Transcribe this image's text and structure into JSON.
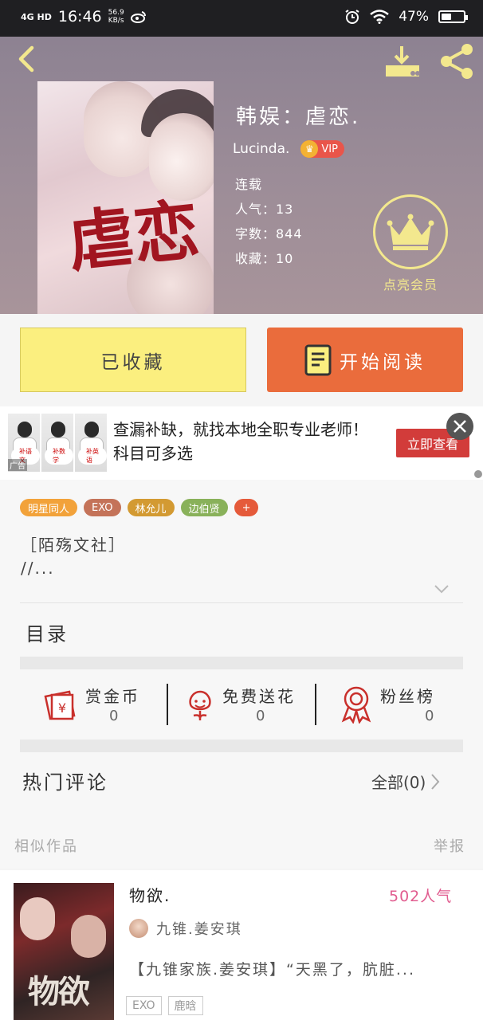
{
  "status_bar": {
    "network": "4G HD",
    "time": "16:46",
    "speed_value": "56.9",
    "speed_unit": "KB/s",
    "battery": "47%",
    "battery_level": 0.47
  },
  "book": {
    "title": "韩娱：虐恋.",
    "cover_char": "虐恋",
    "author": "Lucinda.",
    "vip_label": "VIP",
    "status": "连载",
    "popularity": "人气：13",
    "word_count": "字数：844",
    "favorites": "收藏：10",
    "member_label": "点亮会员"
  },
  "actions": {
    "favorite": "已收藏",
    "read": "开始阅读"
  },
  "ad": {
    "text": "查漏补缺，就找本地全职专业老师！科目可多选",
    "button": "立即查看",
    "mark": "广告",
    "img_tags": [
      "补语文",
      "补数学",
      "补英语"
    ]
  },
  "tags": [
    {
      "label": "明星同人",
      "color": "#f2a23a"
    },
    {
      "label": "EXO",
      "color": "#c47359"
    },
    {
      "label": "林允儿",
      "color": "#d39a32"
    },
    {
      "label": "边伯贤",
      "color": "#89b15a"
    },
    {
      "label": "+",
      "color": "#e55a3a"
    }
  ],
  "description": {
    "line1": "［陌殇文社］",
    "line2": "//..."
  },
  "toc_label": "目录",
  "stats": [
    {
      "title": "赏金币",
      "value": "0"
    },
    {
      "title": "免费送花",
      "value": "0"
    },
    {
      "title": "粉丝榜",
      "value": "0"
    }
  ],
  "comments": {
    "title": "热门评论",
    "all": "全部(0)"
  },
  "similar": {
    "title": "相似作品",
    "report": "举报",
    "item": {
      "title": "物欲.",
      "popularity": "502人气",
      "author": "九锥.姜安琪",
      "desc": "【九锥家族.姜安琪】“天黑了，肮脏...",
      "cover_text": "物欲",
      "tags": [
        "EXO",
        "鹿晗"
      ]
    }
  },
  "colors": {
    "accent_yellow": "#fbef7f",
    "accent_orange": "#ea6c3c",
    "member_gold": "#f3e88e",
    "pop_pink": "#e15c8f"
  }
}
